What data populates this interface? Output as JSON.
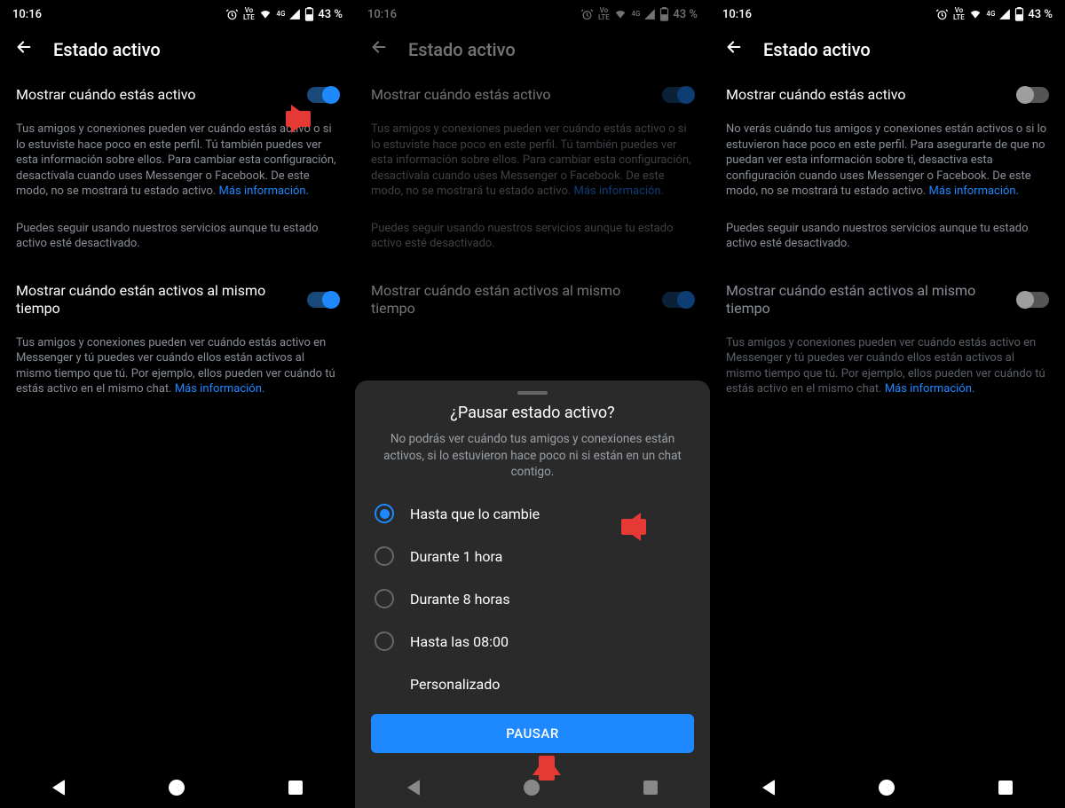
{
  "statusbar": {
    "time": "10:16",
    "net_label": "Vo LTE",
    "net_g": "4G",
    "battery": "43 %"
  },
  "header": {
    "title": "Estado activo"
  },
  "screen1": {
    "toggle1_label": "Mostrar cuándo estás activo",
    "desc1": "Tus amigos y conexiones pueden ver cuándo estás activo o si lo estuviste hace poco en este perfil. Tú también puedes ver esta información sobre ellos. Para cambiar esta configuración, desactívala cuando uses Messenger o Facebook. De este modo, no se mostrará tu estado activo. ",
    "desc1_link": "Más información.",
    "desc1b": "Puedes seguir usando nuestros servicios aunque tu estado activo esté desactivado.",
    "toggle2_label": "Mostrar cuándo están activos al mismo tiempo",
    "desc2": "Tus amigos y conexiones pueden ver cuándo estás activo en Messenger y tú puedes ver cuándo ellos están activos al mismo tiempo que tú. Por ejemplo, ellos pueden ver cuándo tú estás activo en el mismo chat. ",
    "desc2_link": "Más información."
  },
  "screen3": {
    "desc1": "No verás cuándo tus amigos y conexiones están activos o si lo estuvieron hace poco en este perfil. Para asegurarte de que no puedan ver esta información sobre ti, desactiva esta configuración cuando uses Messenger o Facebook. De este modo, no se mostrará tu estado activo. ",
    "desc2": "Tus amigos y conexiones pueden ver cuándo estás activo en Messenger y tú puedes ver cuándo ellos están activos al mismo tiempo que tú. Por ejemplo, ellos pueden ver cuándo tú estás activo en el mismo chat. "
  },
  "sheet": {
    "title": "¿Pausar estado activo?",
    "desc": "No podrás ver cuándo tus amigos y conexiones están activos, si lo estuvieron hace poco ni si están en un chat contigo.",
    "opt1": "Hasta que lo cambie",
    "opt2": "Durante 1 hora",
    "opt3": "Durante 8 horas",
    "opt4": "Hasta las 08:00",
    "opt5": "Personalizado",
    "button": "PAUSAR"
  }
}
